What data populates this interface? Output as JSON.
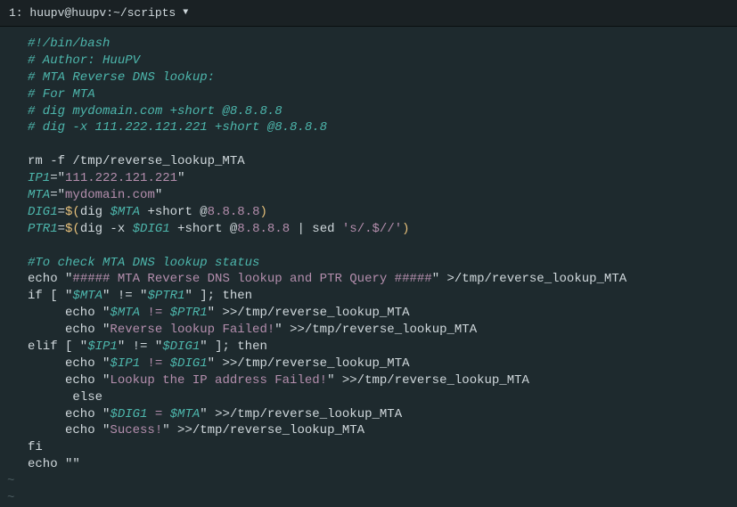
{
  "titlebar": {
    "text": "1: huupv@huupv:~/scripts"
  },
  "code": {
    "l1": "#!/bin/bash",
    "l2": "# Author: HuuPV",
    "l3": "# MTA Reverse DNS lookup:",
    "l4": "# For MTA",
    "l5": "# dig mydomain.com +short @8.8.8.8",
    "l6": "# dig -x 111.222.121.221 +short @8.8.8.8",
    "l7a": "rm -f /tmp/reverse_lookup_MTA",
    "l8a": "IP1",
    "l8b": "=\"",
    "l8c": "111.222.121.221",
    "l8d": "\"",
    "l9a": "MTA",
    "l9b": "=\"",
    "l9c": "mydomain.com",
    "l9d": "\"",
    "l10a": "DIG1",
    "l10b": "=",
    "l10c": "$(",
    "l10d": "dig ",
    "l10e": "$MTA",
    "l10f": " +short @",
    "l10g": "8.8.8.8",
    "l10h": ")",
    "l11a": "PTR1",
    "l11b": "=",
    "l11c": "$(",
    "l11d": "dig -x ",
    "l11e": "$DIG1",
    "l11f": " +short @",
    "l11g": "8.8.8.8",
    "l11h": " | sed ",
    "l11i": "'s/.$//'",
    "l11j": ")",
    "l12": "#To check MTA DNS lookup status",
    "l13a": "echo \"",
    "l13b": "##### MTA Reverse DNS lookup and PTR Query #####",
    "l13c": "\" >/tmp/reverse_lookup_MTA",
    "l14a": "if [ \"",
    "l14b": "$MTA",
    "l14c": "\" != \"",
    "l14d": "$PTR1",
    "l14e": "\" ]; then",
    "l15a": "     echo \"",
    "l15b": "$MTA",
    "l15c": " != ",
    "l15d": "$PTR1",
    "l15e": "\" >>/tmp/reverse_lookup_MTA",
    "l16a": "     echo \"",
    "l16b": "Reverse lookup Failed!",
    "l16c": "\" >>/tmp/reverse_lookup_MTA",
    "l17a": "elif [ \"",
    "l17b": "$IP1",
    "l17c": "\" != \"",
    "l17d": "$DIG1",
    "l17e": "\" ]; then",
    "l18a": "     echo \"",
    "l18b": "$IP1",
    "l18c": " != ",
    "l18d": "$DIG1",
    "l18e": "\" >>/tmp/reverse_lookup_MTA",
    "l19a": "     echo \"",
    "l19b": "Lookup the IP address Failed!",
    "l19c": "\" >>/tmp/reverse_lookup_MTA",
    "l20": "      else",
    "l21a": "     echo \"",
    "l21b": "$DIG1",
    "l21c": " = ",
    "l21d": "$MTA",
    "l21e": "\" >>/tmp/reverse_lookup_MTA",
    "l22a": "     echo \"",
    "l22b": "Sucess!",
    "l22c": "\" >>/tmp/reverse_lookup_MTA",
    "l23": "fi",
    "l24": "echo \"\"",
    "tilde": "~"
  }
}
